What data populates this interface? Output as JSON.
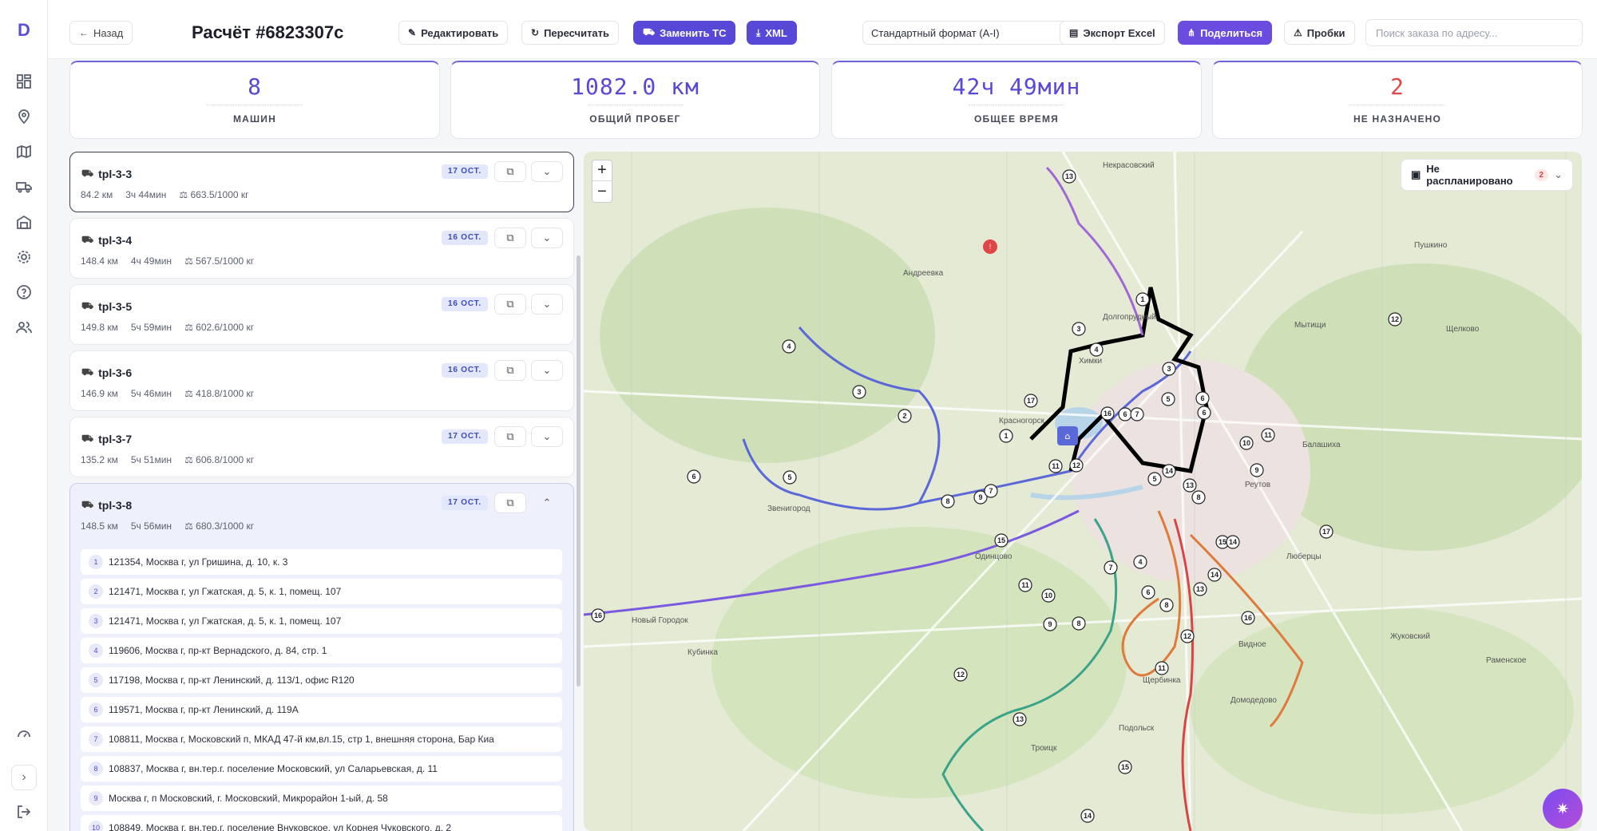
{
  "app": {
    "logo": "D"
  },
  "header": {
    "back_label": "Назад",
    "title": "Расчёт #6823307c",
    "edit_label": "Редактировать",
    "recalc_label": "Пересчитать",
    "replace_label": "Заменить ТС",
    "xml_label": "XML",
    "format_value": "Стандартный формат (A-I)",
    "export_label": "Экспорт Excel",
    "share_label": "Поделиться",
    "traffic_label": "Пробки",
    "search_placeholder": "Поиск заказа по адресу..."
  },
  "stats": [
    {
      "value": "8",
      "label": "МАШИН"
    },
    {
      "value": "1082.0 км",
      "label": "ОБЩИЙ ПРОБЕГ"
    },
    {
      "value": "42ч 49мин",
      "label": "ОБЩЕЕ ВРЕМЯ"
    },
    {
      "value": "2",
      "label": "НЕ НАЗНАЧЕНО"
    }
  ],
  "vehicles": [
    {
      "name": "tpl-3-3",
      "km": "84.2 км",
      "time": "3ч 44мин",
      "load": "663.5/1000 кг",
      "date": "17 ОСТ."
    },
    {
      "name": "tpl-3-4",
      "km": "148.4 км",
      "time": "4ч 49мин",
      "load": "567.5/1000 кг",
      "date": "16 ОСТ."
    },
    {
      "name": "tpl-3-5",
      "km": "149.8 км",
      "time": "5ч 59мин",
      "load": "602.6/1000 кг",
      "date": "16 ОСТ."
    },
    {
      "name": "tpl-3-6",
      "km": "146.9 км",
      "time": "5ч 46мин",
      "load": "418.8/1000 кг",
      "date": "16 ОСТ."
    },
    {
      "name": "tpl-3-7",
      "km": "135.2 км",
      "time": "5ч 51мин",
      "load": "606.8/1000 кг",
      "date": "17 ОСТ."
    },
    {
      "name": "tpl-3-8",
      "km": "148.5 км",
      "time": "5ч 56мин",
      "load": "680.3/1000 кг",
      "date": "17 ОСТ."
    }
  ],
  "stops": [
    "121354, Москва г, ул Гришина, д. 10, к. 3",
    "121471, Москва г, ул Гжатская, д. 5, к. 1, помещ. 107",
    "121471, Москва г, ул Гжатская, д. 5, к. 1, помещ. 107",
    "119606, Москва г, пр-кт Вернадского, д. 84, стр. 1",
    "117198, Москва г, пр-кт Ленинский, д. 113/1, офис R120",
    "119571, Москва г, пр-кт Ленинский, д. 119А",
    "108811, Москва г, Московский п, МКАД 47-й км,вл.15, стр 1, внешняя сторона, Бар Киа",
    "108837, Москва г, вн.тер.г. поселение Московский, ул Саларьевская, д. 11",
    "Москва г, п Московский, г. Московский, Микрорайон 1-ый, д. 58",
    "108849, Москва г, вн.тер.г. поселение Внуковское, ул Корнея Чуковского, д. 2"
  ],
  "map": {
    "unplanned_label": "Не распланировано",
    "unplanned_count": "2",
    "places": [
      "Пушкино",
      "Мытищи",
      "Щелково",
      "Долгопрудный",
      "Химки",
      "Балашиха",
      "Реутов",
      "Люберцы",
      "Одинцово",
      "Видное",
      "Домодедово",
      "Подольск",
      "Звенигород",
      "Красногорск",
      "Жуковский",
      "Раменское",
      "Троицк",
      "Андреевка",
      "Некрасовский",
      "Новый Городок",
      "Кубинка",
      "Щербинка"
    ],
    "route_colors": [
      "#000000",
      "#5a68d8",
      "#7a58e0",
      "#3aa38a",
      "#e07a3a",
      "#d84545",
      "#a066d6",
      "#e0a040"
    ]
  }
}
